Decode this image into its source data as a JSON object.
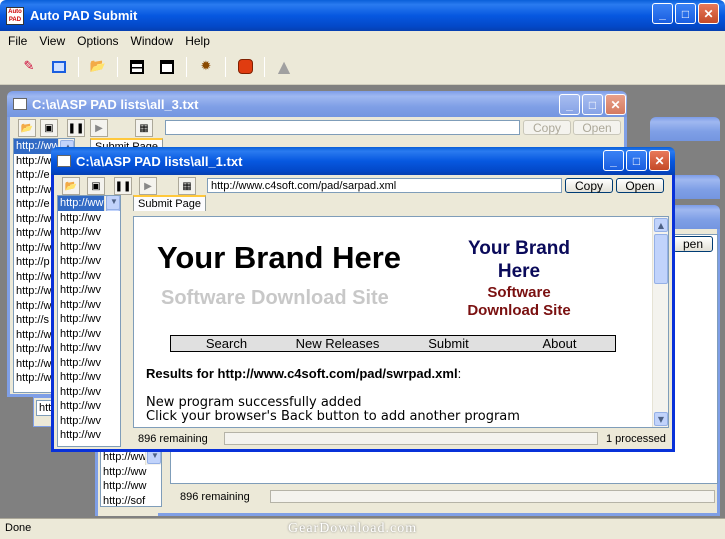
{
  "app": {
    "title": "Auto PAD Submit",
    "logo_text": "Auto PAD",
    "menu": [
      "File",
      "View",
      "Options",
      "Window",
      "Help"
    ],
    "toolbar_icons": [
      "pad-wizard-icon",
      "window-icon",
      "open-folder-icon",
      "tile-horizontal-icon",
      "cascade-icon",
      "settings-gear-icon",
      "stop-icon",
      "triangle-up-icon"
    ],
    "status_text": "Done",
    "watermark": "GearDownload.com"
  },
  "child_back": {
    "title": "C:\\a\\ASP PAD lists\\all_3.txt",
    "url_value": "",
    "copy_label": "Copy",
    "open_label": "Open",
    "tab_label": "Submit Page",
    "list_items": [
      "http://ww",
      "http://w",
      "http://e",
      "http://w",
      "http://e",
      "http://w",
      "http://w",
      "http://w",
      "http://p",
      "http://w",
      "http://w",
      "http://w",
      "http://s",
      "http://w",
      "http://w",
      "http://w",
      "http://w",
      "http://w"
    ]
  },
  "child_third": {
    "list_items": [
      "http://ww",
      "http://ww",
      "http://ww",
      "http://sof"
    ],
    "remaining_text": "896 remaining",
    "open_label": "pen"
  },
  "child_front": {
    "title": "C:\\a\\ASP PAD lists\\all_1.txt",
    "url_value": "http://www.c4soft.com/pad/sarpad.xml",
    "copy_label": "Copy",
    "open_label": "Open",
    "tab_label": "Submit Page",
    "list_items": [
      "http://ww",
      "http://wv",
      "http://wv",
      "http://wv",
      "http://wv",
      "http://wv",
      "http://wv",
      "http://wv",
      "http://wv",
      "http://wv",
      "http://wv",
      "http://wv",
      "http://wv",
      "http://wv",
      "http://wv",
      "http://wv",
      "http://wv"
    ],
    "remaining_text": "896 remaining",
    "processed_text": "1 processed",
    "page": {
      "brand_large": "Your Brand Here",
      "site_large": "Software Download Site",
      "brand_small_line1": "Your Brand",
      "brand_small_line2": "Here",
      "site_small_line1": "Software",
      "site_small_line2": "Download Site",
      "nav": [
        "Search",
        "New Releases",
        "Submit",
        "About"
      ],
      "results_label": "Results for http://www.c4soft.com/pad/swrpad.xml",
      "results_colon": ":",
      "msg1": "New program successfully added",
      "msg2": "Click your browser's Back button to add another program"
    }
  },
  "colors": {
    "titlebar_active": "#0a5fd8",
    "titlebar_inactive": "#7f9fe6",
    "brand_dark": "#0a0a5a",
    "brand_red": "#7a1010",
    "site_gray": "#c8c8c8",
    "selection": "#316ac5"
  }
}
